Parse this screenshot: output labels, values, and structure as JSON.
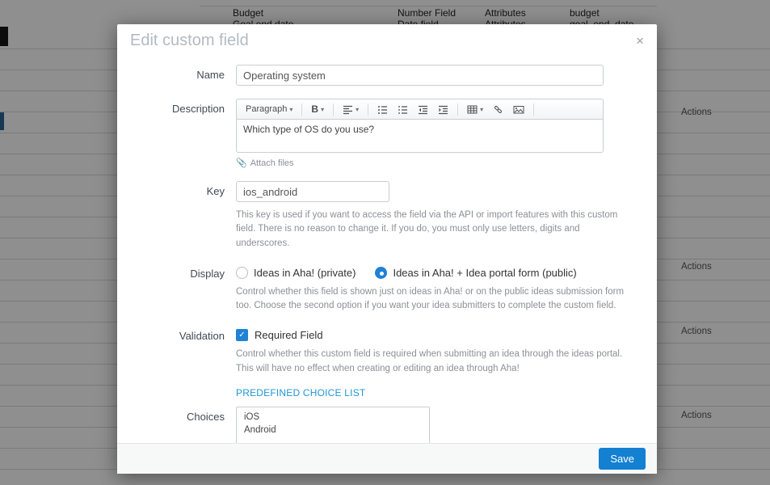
{
  "background": {
    "table": {
      "rows": [
        {
          "name": "Budget",
          "type": "Number Field",
          "attributes": "Attributes",
          "key": "budget"
        },
        {
          "name": "Goal end date",
          "type": "Date field",
          "attributes": "Attributes",
          "key": "goal_end_date"
        }
      ]
    },
    "actions_label": "Actions"
  },
  "icons": {
    "close": "×",
    "caret": "▾",
    "check": "✓",
    "paperclip": "📎"
  },
  "modal": {
    "title": "Edit custom field",
    "name": {
      "label": "Name",
      "value": "Operating system"
    },
    "description": {
      "label": "Description",
      "toolbar": {
        "paragraph": "Paragraph",
        "bold": "B"
      },
      "value": "Which type of OS do you use?",
      "attach_label": "Attach files"
    },
    "key": {
      "label": "Key",
      "value": "ios_android",
      "help": "This key is used if you want to access the field via the API or import features with this custom field. There is no reason to change it. If you do, you must only use letters, digits and underscores."
    },
    "display": {
      "label": "Display",
      "options": [
        {
          "label": "Ideas in Aha! (private)",
          "selected": false
        },
        {
          "label": "Ideas in Aha! + Idea portal form (public)",
          "selected": true
        }
      ],
      "help": "Control whether this field is shown just on ideas in Aha! or on the public ideas submission form too. Choose the second option if you want your idea submitters to complete the custom field."
    },
    "validation": {
      "label": "Validation",
      "checkbox_label": "Required Field",
      "checked": true,
      "help": "Control whether this custom field is required when submitting an idea through the ideas portal. This will have no effect when creating or editing an idea through Aha!"
    },
    "predefined_link": "PREDEFINED CHOICE LIST",
    "choices": {
      "label": "Choices",
      "items": [
        {
          "text": "iOS"
        },
        {
          "text": "Android"
        }
      ]
    },
    "footer": {
      "save_label": "Save"
    }
  }
}
